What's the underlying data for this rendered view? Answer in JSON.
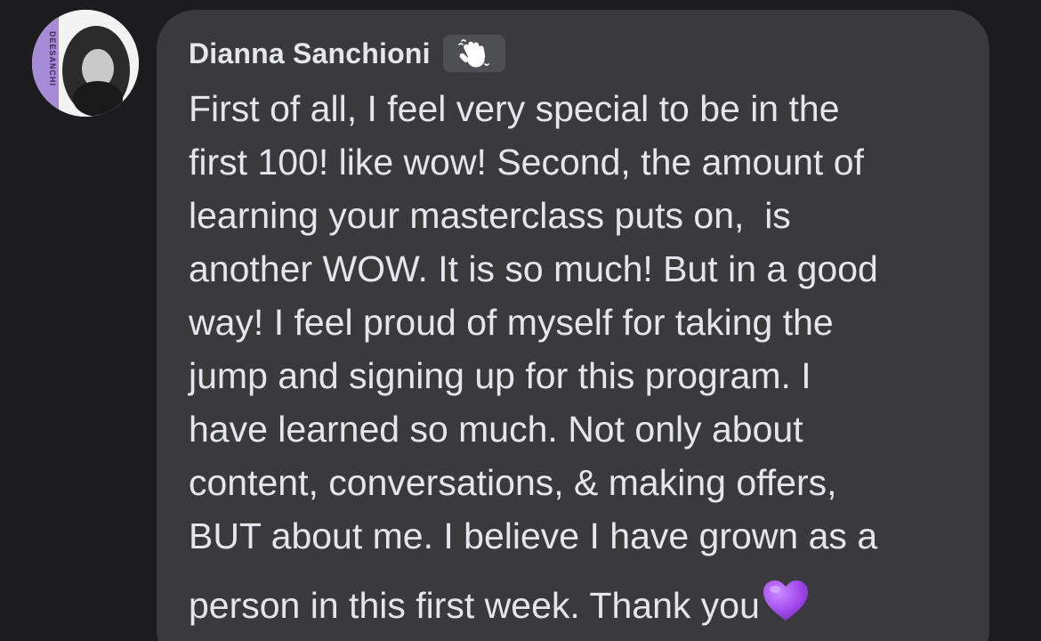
{
  "comment": {
    "author": "Dianna Sanchioni",
    "avatar_text": "DEESANCHI",
    "badge_icon": "waving-hand-icon",
    "message_lines": [
      "First of all, I feel very special to be in the",
      "first 100! like wow! Second, the amount of",
      "learning your masterclass puts on,  is",
      "another WOW. It is so much! But in a good",
      "way! I feel proud of myself for taking the",
      "jump and signing up for this program. I",
      "have learned so much. Not only about",
      "content, conversations, & making offers,",
      "BUT about me. I believe I have grown as a",
      "person in this first week. Thank you"
    ],
    "trailing_emoji": "purple-heart-icon"
  },
  "colors": {
    "background": "#1c1c1e",
    "bubble": "#3a3a3c",
    "text": "#e4e6eb",
    "badge": "#4e4f52",
    "avatar_accent": "#a58bd8",
    "heart": "#a64df0"
  }
}
